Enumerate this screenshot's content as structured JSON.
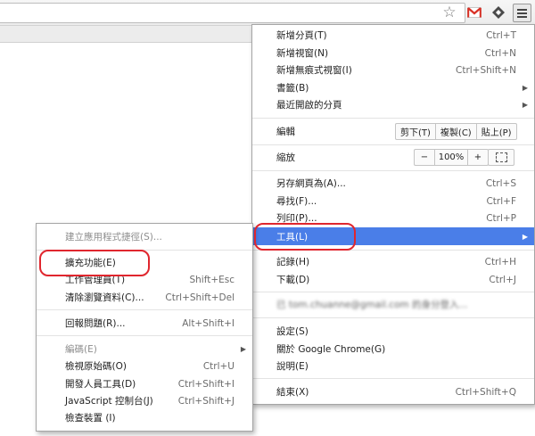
{
  "toolbar": {
    "star_icon": "star-icon",
    "gmail_icon": "gmail-icon",
    "extension_icon": "extension-icon",
    "menu_icon": "hamburger-menu-icon"
  },
  "main_menu": {
    "new_tab": {
      "label": "新增分頁(T)",
      "shortcut": "Ctrl+T"
    },
    "new_window": {
      "label": "新增視窗(N)",
      "shortcut": "Ctrl+N"
    },
    "new_incognito": {
      "label": "新增無痕式視窗(I)",
      "shortcut": "Ctrl+Shift+N"
    },
    "bookmarks": {
      "label": "書籤(B)"
    },
    "recent_tabs": {
      "label": "最近開啟的分頁"
    },
    "edit": {
      "label": "編輯",
      "cut": "剪下(T)",
      "copy": "複製(C)",
      "paste": "貼上(P)"
    },
    "zoom": {
      "label": "縮放",
      "minus": "−",
      "value": "100%",
      "plus": "+"
    },
    "save_as": {
      "label": "另存網頁為(A)...",
      "shortcut": "Ctrl+S"
    },
    "find": {
      "label": "尋找(F)...",
      "shortcut": "Ctrl+F"
    },
    "print": {
      "label": "列印(P)...",
      "shortcut": "Ctrl+P"
    },
    "tools": {
      "label": "工具(L)"
    },
    "history": {
      "label": "記錄(H)",
      "shortcut": "Ctrl+H"
    },
    "downloads": {
      "label": "下載(D)",
      "shortcut": "Ctrl+J"
    },
    "signed_in": {
      "label": "已 tom.chuanne@gmail.com 的身分登入..."
    },
    "settings": {
      "label": "設定(S)"
    },
    "about": {
      "label": "關於 Google Chrome(G)"
    },
    "help": {
      "label": "說明(E)"
    },
    "exit": {
      "label": "結束(X)",
      "shortcut": "Ctrl+Shift+Q"
    }
  },
  "tools_menu": {
    "create_shortcuts": {
      "label": "建立應用程式捷徑(S)..."
    },
    "extensions": {
      "label": "擴充功能(E)"
    },
    "task_manager": {
      "label": "工作管理員(T)",
      "shortcut": "Shift+Esc"
    },
    "clear_data": {
      "label": "清除瀏覽資料(C)...",
      "shortcut": "Ctrl+Shift+Del"
    },
    "report_issue": {
      "label": "回報問題(R)...",
      "shortcut": "Alt+Shift+I"
    },
    "encoding": {
      "label": "編碼(E)"
    },
    "view_source": {
      "label": "檢視原始碼(O)",
      "shortcut": "Ctrl+U"
    },
    "dev_tools": {
      "label": "開發人員工具(D)",
      "shortcut": "Ctrl+Shift+I"
    },
    "js_console": {
      "label": "JavaScript 控制台(J)",
      "shortcut": "Ctrl+Shift+J"
    },
    "inspect_devices": {
      "label": "檢查裝置 (I)"
    }
  },
  "colors": {
    "highlight": "#4a7ee8",
    "annotation": "#e0262e"
  }
}
